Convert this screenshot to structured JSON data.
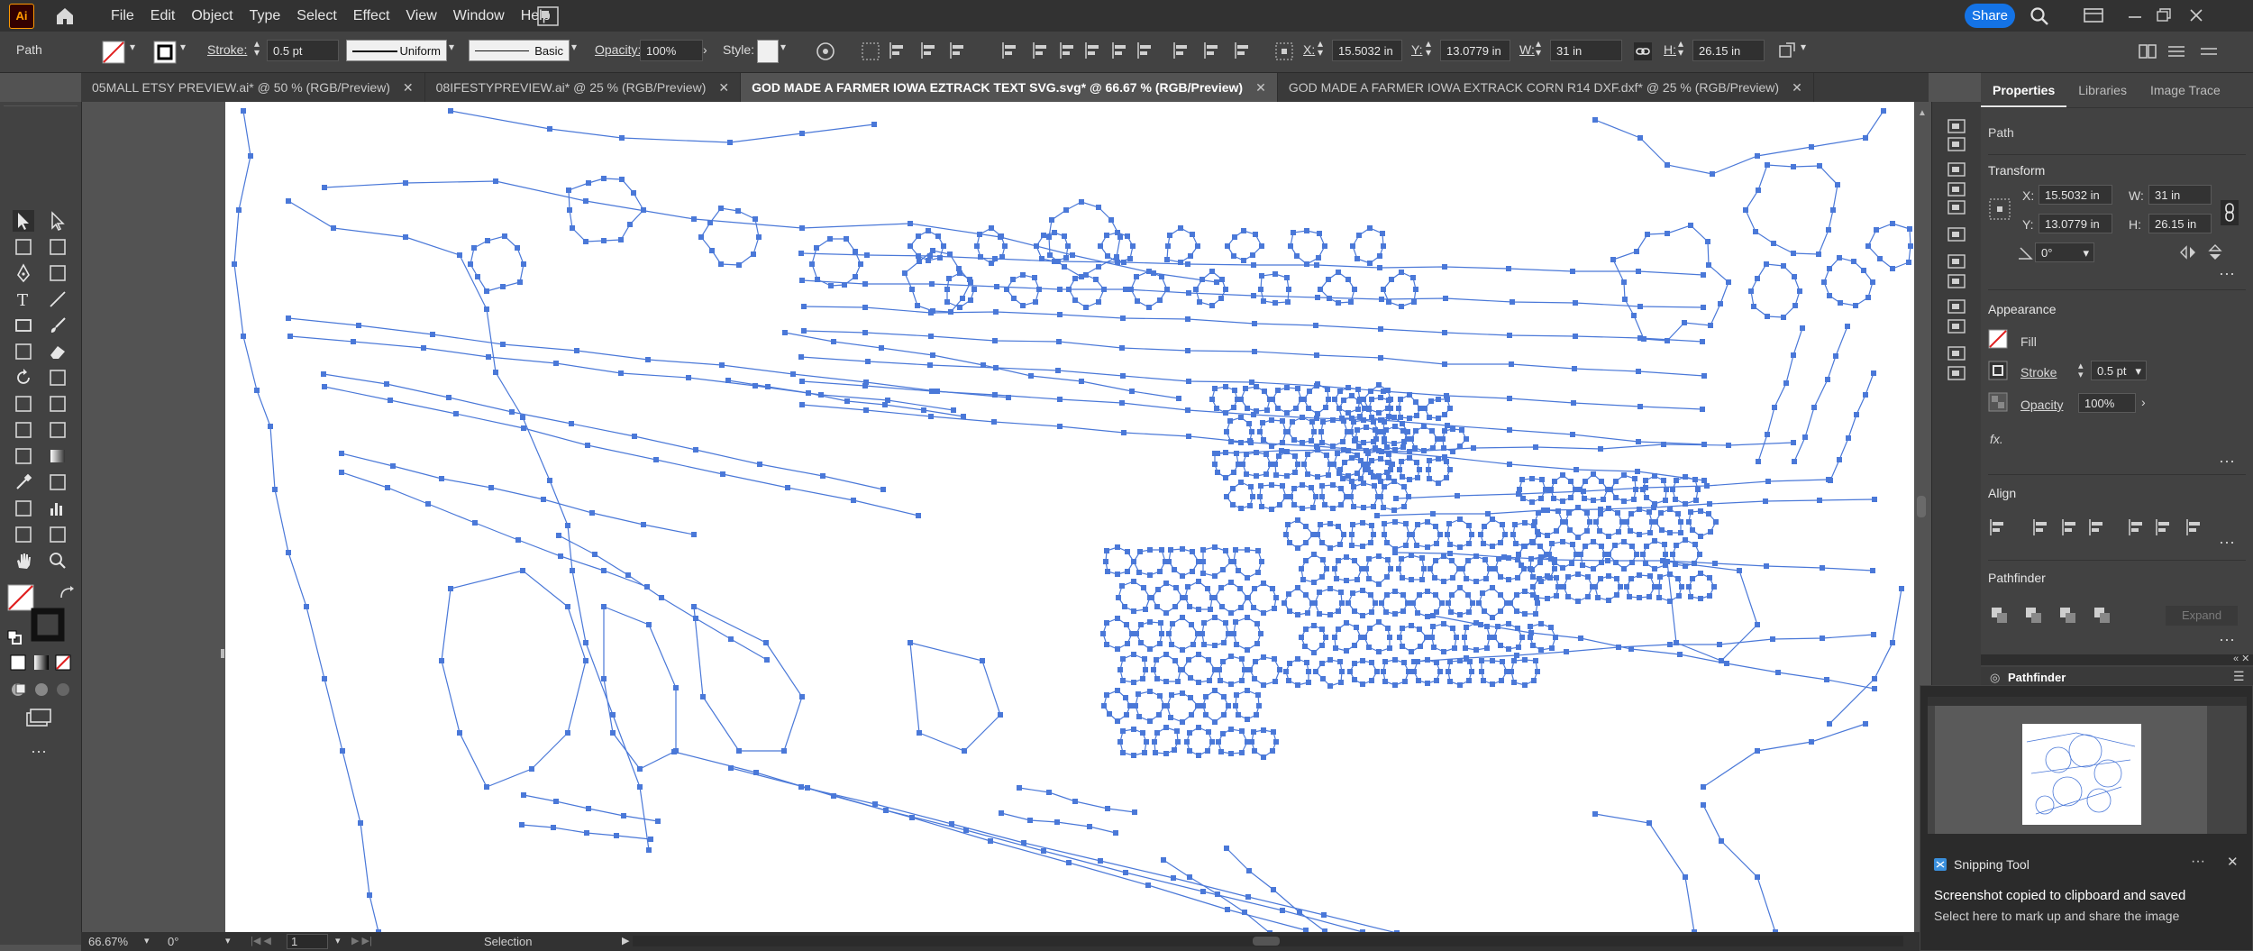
{
  "app": {
    "logo": "Ai"
  },
  "menu": [
    "File",
    "Edit",
    "Object",
    "Type",
    "Select",
    "Effect",
    "View",
    "Window",
    "Help"
  ],
  "share_label": "Share",
  "control_bar": {
    "selection_type": "Path",
    "stroke_label": "Stroke:",
    "stroke_value": "0.5 pt",
    "profile_uniform": "Uniform",
    "brush_basic": "Basic",
    "opacity_label": "Opacity:",
    "opacity_value": "100%",
    "style_label": "Style:",
    "x_label": "X:",
    "x_value": "15.5032 in",
    "y_label": "Y:",
    "y_value": "13.0779 in",
    "w_label": "W:",
    "w_value": "31 in",
    "h_label": "H:",
    "h_value": "26.15 in"
  },
  "tabs": [
    {
      "label": "05MALL ETSY PREVIEW.ai* @ 50 % (RGB/Preview)",
      "active": false
    },
    {
      "label": "08IFESTYPREVIEW.ai* @ 25 % (RGB/Preview)",
      "active": false
    },
    {
      "label": "GOD MADE A FARMER IOWA EZTRACK TEXT SVG.svg* @ 66.67 % (RGB/Preview)",
      "active": true
    },
    {
      "label": "GOD MADE A FARMER IOWA EXTRACK CORN R14 DXF.dxf* @ 25 % (RGB/Preview)",
      "active": false
    }
  ],
  "properties_panel": {
    "tabs": [
      "Properties",
      "Libraries",
      "Image Trace"
    ],
    "section_path": "Path",
    "transform_title": "Transform",
    "x_label": "X:",
    "x_value": "15.5032 in",
    "y_label": "Y:",
    "y_value": "13.0779 in",
    "w_label": "W:",
    "w_value": "31 in",
    "h_label": "H:",
    "h_value": "26.15 in",
    "angle_value": "0°",
    "appearance_title": "Appearance",
    "fill_label": "Fill",
    "stroke_label": "Stroke",
    "stroke_value": "0.5 pt",
    "opacity_label": "Opacity",
    "opacity_value": "100%",
    "fx_label": "fx.",
    "align_title": "Align",
    "pathfinder_title": "Pathfinder",
    "expand_label": "Expand",
    "pathfinder_mini_label": "Pathfinder"
  },
  "status_bar": {
    "zoom": "66.67%",
    "rotation": "0°",
    "artboard_number": "1",
    "tool_name": "Selection"
  },
  "snipping_tool": {
    "app_name": "Snipping Tool",
    "message": "Screenshot copied to clipboard and saved",
    "sub_message": "Select here to mark up and share the image"
  },
  "colors": {
    "path_blue": "#4a78d8",
    "accent_share": "#1473e6",
    "app_orange": "#ff9a00"
  }
}
